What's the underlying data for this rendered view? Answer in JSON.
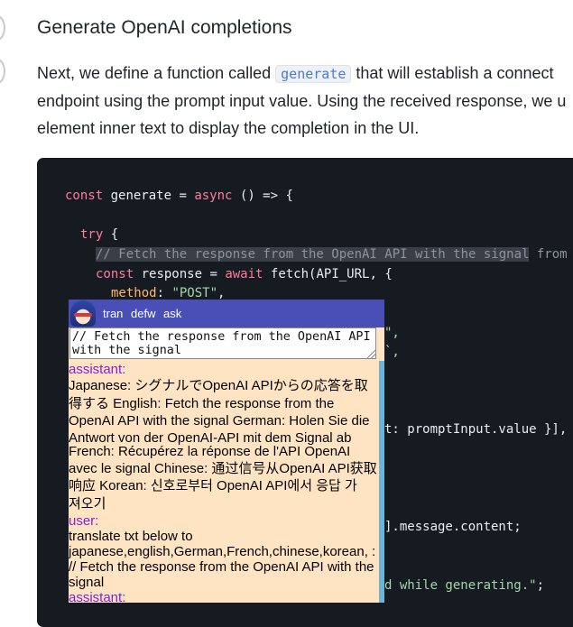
{
  "article": {
    "heading": "Generate OpenAI completions",
    "para": {
      "line1_before": "Next, we define a function called ",
      "line1_code": "generate",
      "line1_after": " that will establish a connect",
      "line2": "endpoint using the prompt input value. Using the received response, we u",
      "line3": "element inner text to display the completion in the UI."
    }
  },
  "code": {
    "l1_kw1": "const",
    "l1_mid": " generate = ",
    "l1_kw2": "async",
    "l1_end": " () => {",
    "l2_kw": "try",
    "l2_end": " {",
    "l3_comment": "// Fetch the response from the OpenAI API with the signal",
    "l3_tail": " from",
    "l4_kw1": "const",
    "l4_mid": " response = ",
    "l4_kw2": "await",
    "l4_end": " fetch(API_URL, {",
    "l5_prop": "method",
    "l5_colon": ": ",
    "l5_str": "\"POST\"",
    "l5_end": ",",
    "frag1": "\",",
    "frag2": "`,",
    "frag3": "t: promptInput.value }],",
    "frag4": "].message.content;",
    "frag5_str": "d while generating.\"",
    "frag5_end": ";"
  },
  "popup": {
    "tabs": [
      "tran",
      "defw",
      "ask"
    ],
    "prompt_value": "// Fetch the response from the OpenAI API with the signal",
    "assistant_label": "assistant:",
    "assistant_lines": [
      "Japanese: シグナルでOpenAI APIからの応答を取",
      "得する English: Fetch the response from the",
      "OpenAI API with the signal German: Holen Sie die",
      "Antwort von der OpenAI-API mit dem Signal ab",
      "French: Récupérez la réponse de l'API OpenAI",
      "avec le signal Chinese: 通过信号从OpenAI API获取",
      "响应 Korean: 신호로부터 OpenAI API에서 응답 가",
      "져오기"
    ],
    "user_label": "user:",
    "user_lines": [
      "translate txt below to",
      "japanese,english,German,French,chinese,korean, :",
      "// Fetch the response from the OpenAI API with the",
      "signal"
    ],
    "assistant2_label": "assistant:"
  }
}
